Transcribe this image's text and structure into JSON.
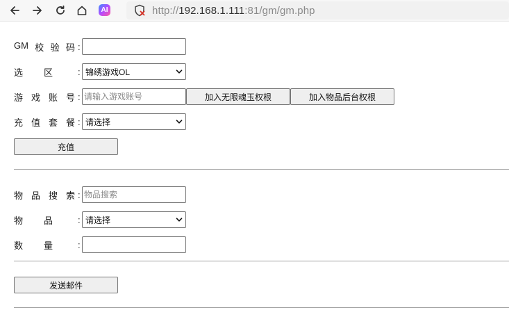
{
  "browser": {
    "address_url_prefix": "http://",
    "address_url_host": "192.168.1.111",
    "address_url_rest": ":81/gm/gm.php",
    "ai_badge": "AI"
  },
  "form": {
    "gm_code": {
      "label_chars": [
        "GM",
        "校",
        "验",
        "码"
      ],
      "colon": ":",
      "value": ""
    },
    "server": {
      "label_chars": [
        "选",
        "区"
      ],
      "colon": ":",
      "selected": "锦绣游戏OL"
    },
    "account": {
      "label_chars": [
        "游",
        "戏",
        "账",
        "号"
      ],
      "colon": ":",
      "placeholder": "请输入游戏账号",
      "btn_unlimited": "加入无限魂玉权根",
      "btn_item_admin": "加入物品后台权根"
    },
    "package": {
      "label_chars": [
        "充",
        "值",
        "套",
        "餐"
      ],
      "colon": ":",
      "selected": "请选择"
    },
    "recharge_button": "充值"
  },
  "mail": {
    "item_search": {
      "label_chars": [
        "物",
        "品",
        "搜",
        "索"
      ],
      "colon": ":",
      "placeholder": "物品搜索"
    },
    "item": {
      "label_chars": [
        "物",
        "品"
      ],
      "colon": ":",
      "selected": "请选择"
    },
    "quantity": {
      "label_chars": [
        "数",
        "量"
      ],
      "colon": ":",
      "value": ""
    },
    "send_button": "发送邮件"
  }
}
